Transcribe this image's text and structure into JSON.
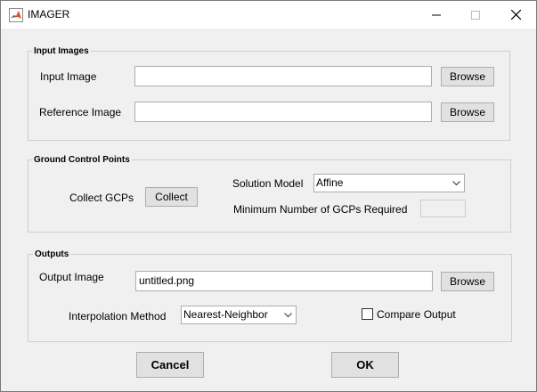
{
  "window": {
    "title": "IMAGER",
    "icons": {
      "app": "matlab-icon",
      "minimize": "minimize-icon",
      "maximize": "maximize-icon",
      "close": "close-icon"
    }
  },
  "input_images": {
    "title": "Input Images",
    "input_label": "Input Image",
    "input_value": "",
    "reference_label": "Reference Image",
    "reference_value": "",
    "browse_label": "Browse"
  },
  "gcp": {
    "title": "Ground Control Points",
    "collect_label": "Collect GCPs",
    "collect_button": "Collect",
    "solution_label": "Solution Model",
    "solution_value": "Affine",
    "min_label": "Minimum Number of GCPs Required",
    "min_value": ""
  },
  "outputs": {
    "title": "Outputs",
    "output_label": "Output Image",
    "output_value": "untitled.png",
    "browse_label": "Browse",
    "interp_label": "Interpolation Method",
    "interp_value": "Nearest-Neighbor",
    "compare_label": "Compare Output",
    "compare_checked": false
  },
  "actions": {
    "cancel": "Cancel",
    "ok": "OK"
  }
}
